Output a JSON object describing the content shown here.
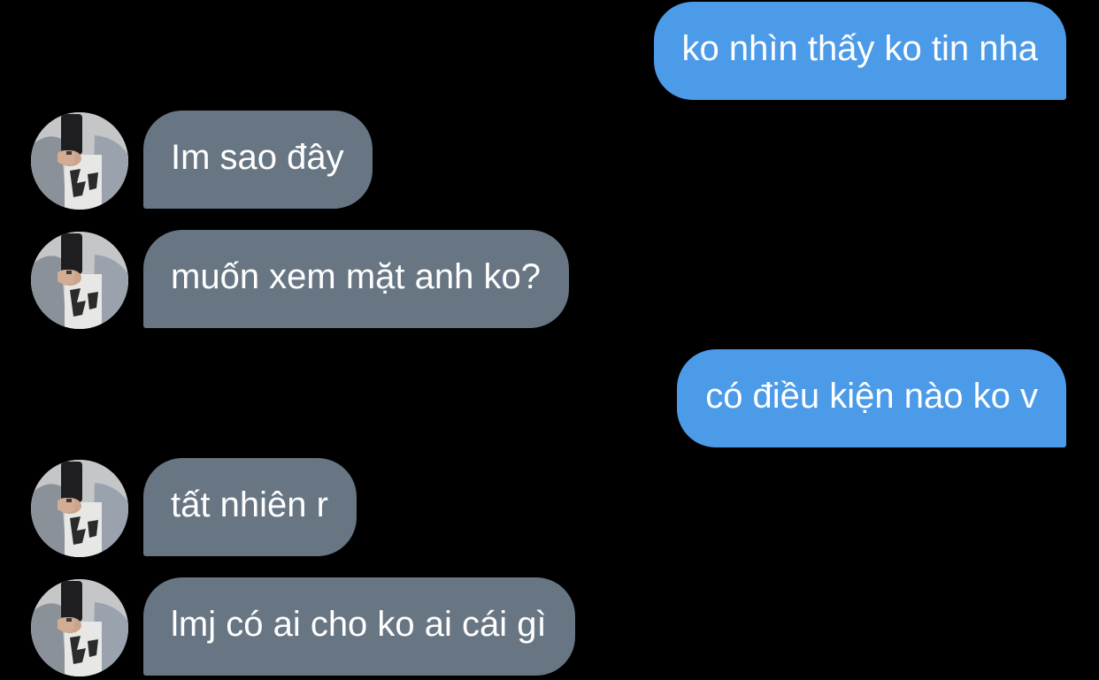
{
  "messages": [
    {
      "direction": "outgoing",
      "text": "ko nhìn thấy ko tin nha"
    },
    {
      "direction": "incoming",
      "text": "Im sao đây",
      "avatar": "selfie-avatar"
    },
    {
      "direction": "incoming",
      "text": "muốn xem mặt anh ko?",
      "avatar": "selfie-avatar"
    },
    {
      "direction": "outgoing",
      "text": "có điều kiện nào ko v"
    },
    {
      "direction": "incoming",
      "text": "tất nhiên r",
      "avatar": "selfie-avatar"
    },
    {
      "direction": "incoming",
      "text": "lmj có ai cho ko ai cái gì",
      "avatar": "selfie-avatar"
    }
  ],
  "colors": {
    "background": "#000000",
    "outgoing_bubble": "#4c9be9",
    "incoming_bubble": "#687684",
    "text": "#ffffff"
  }
}
